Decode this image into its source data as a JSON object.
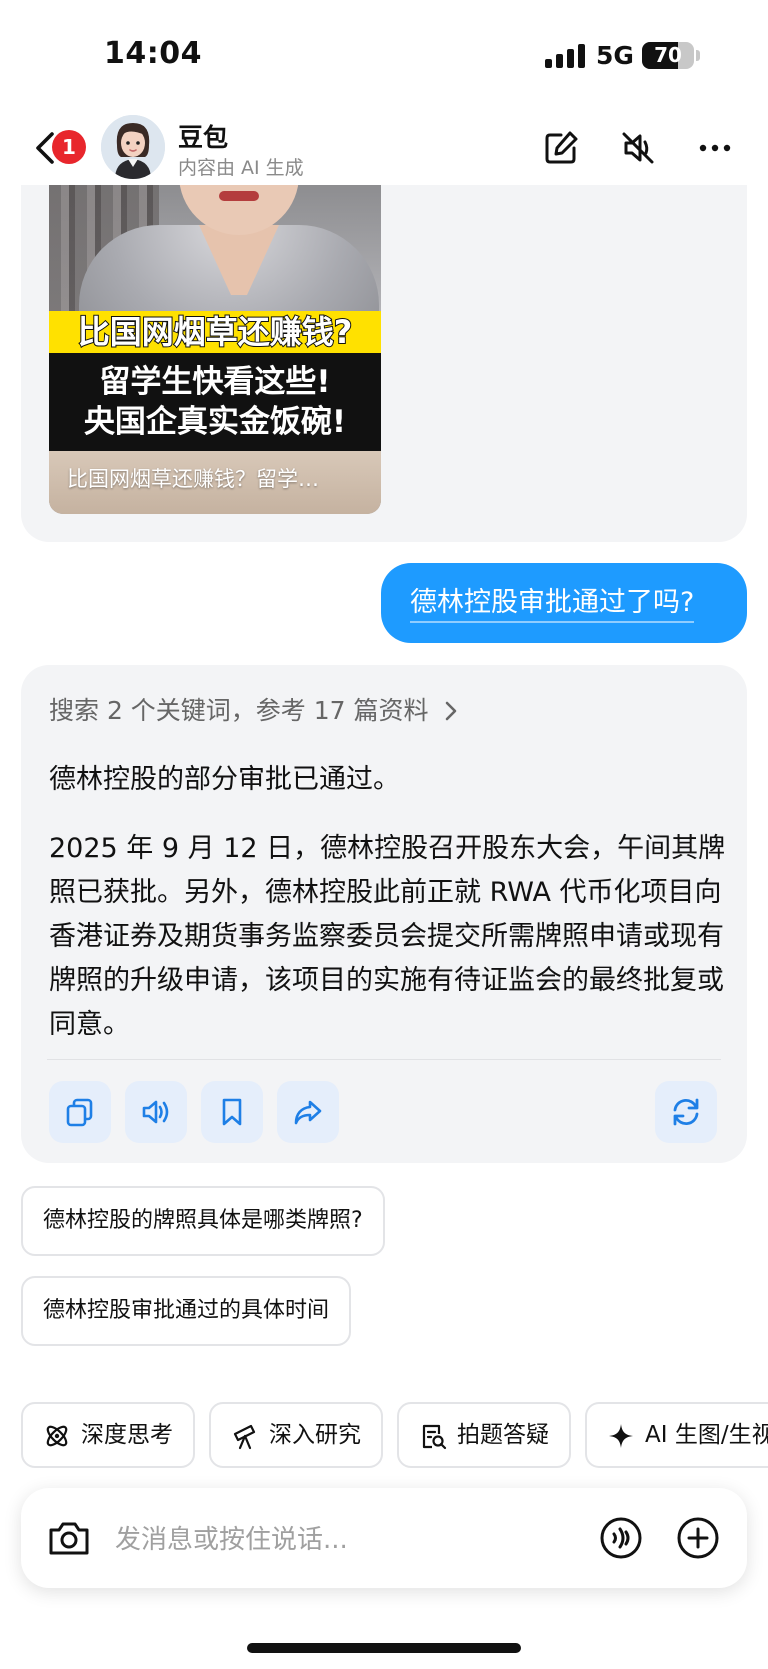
{
  "status_bar": {
    "time": "14:04",
    "network": "5G",
    "battery": "70",
    "battery_level": 0.7
  },
  "header": {
    "back_badge": "1",
    "bot_name": "豆包",
    "bot_subtitle": "内容由 AI 生成"
  },
  "video_card": {
    "title_line1": "比国网烟草还赚钱?",
    "title_line2": "留学生快看这些!",
    "title_line3": "央国企真实金饭碗!",
    "caption": "比国网烟草还赚钱？留学…"
  },
  "user_message": "德林控股审批通过了吗?",
  "reply": {
    "search_summary": "搜索 2 个关键词，参考 17 篇资料",
    "paragraph1": "德林控股的部分审批已通过。",
    "paragraph2": "2025 年 9 月 12 日，德林控股召开股东大会，午间其牌照已获批。另外，德林控股此前正就 RWA 代币化项目向香港证券及期货事务监察委员会提交所需牌照申请或现有牌照的升级申请，该项目的实施有待证监会的最终批复或同意。"
  },
  "suggestions": [
    "德林控股的牌照具体是哪类牌照?",
    "德林控股审批通过的具体时间"
  ],
  "chips": [
    "深度思考",
    "深入研究",
    "拍题答疑",
    "AI 生图/生视频"
  ],
  "input": {
    "placeholder": "发消息或按住说话..."
  },
  "colors": {
    "accent": "#1e9bff",
    "badge": "#e8262c",
    "card_bg": "#f3f4f6",
    "action_bg": "#e5eefb"
  }
}
